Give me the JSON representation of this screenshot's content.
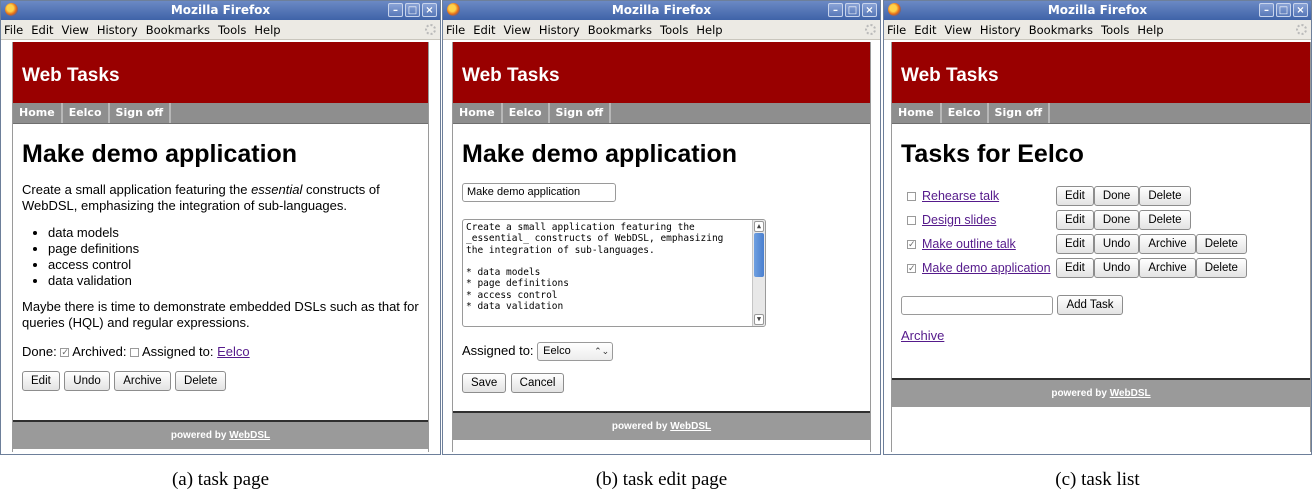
{
  "browser": {
    "title": "Mozilla Firefox",
    "menu": [
      "File",
      "Edit",
      "View",
      "History",
      "Bookmarks",
      "Tools",
      "Help"
    ],
    "window_buttons": [
      "–",
      "□",
      "×"
    ]
  },
  "site": {
    "brand": "Web Tasks",
    "nav": [
      "Home",
      "Eelco",
      "Sign off"
    ],
    "footer_prefix": "powered by ",
    "footer_link": "WebDSL"
  },
  "task_page": {
    "title": "Make demo application",
    "intro_before": "Create a small application featuring the ",
    "intro_em": "essential",
    "intro_after": " constructs of WebDSL, emphasizing the integration of sub-languages.",
    "bullets": [
      "data models",
      "page definitions",
      "access control",
      "data validation"
    ],
    "note": "Maybe there is time to demonstrate embedded DSLs such as that for queries (HQL) and regular expressions.",
    "done_label": "Done:",
    "archived_label": "Archived:",
    "assigned_label": "Assigned to:",
    "assigned_user": "Eelco",
    "done_checked": true,
    "archived_checked": false,
    "buttons": [
      "Edit",
      "Undo",
      "Archive",
      "Delete"
    ]
  },
  "task_edit_page": {
    "title": "Make demo application",
    "name_value": "Make demo application",
    "description_lines": [
      "Create a small application featuring the",
      "_essential_ constructs of WebDSL, emphasizing",
      "the integration of sub-languages.",
      "",
      "* data models",
      "* page definitions",
      "* access control",
      "* data validation"
    ],
    "assigned_label": "Assigned to:",
    "assigned_value": "Eelco",
    "save_label": "Save",
    "cancel_label": "Cancel"
  },
  "task_list": {
    "title": "Tasks for Eelco",
    "tasks": [
      {
        "name": "Rehearse talk",
        "checked": false,
        "buttons": [
          "Edit",
          "Done",
          "Delete"
        ]
      },
      {
        "name": "Design slides",
        "checked": false,
        "buttons": [
          "Edit",
          "Done",
          "Delete"
        ]
      },
      {
        "name": "Make outline talk",
        "checked": true,
        "buttons": [
          "Edit",
          "Undo",
          "Archive",
          "Delete"
        ]
      },
      {
        "name": "Make demo application",
        "checked": true,
        "buttons": [
          "Edit",
          "Undo",
          "Archive",
          "Delete"
        ]
      }
    ],
    "add_task_label": "Add Task",
    "new_task_value": "",
    "archive_link": "Archive"
  },
  "captions": [
    "(a) task page",
    "(b) task edit page",
    "(c) task list"
  ],
  "colors": {
    "header_bg": "#990000",
    "nav_bg": "#8e8e8e",
    "footer_bg": "#9a9a9a",
    "titlebar": "#4a6db4",
    "link": "#551a8b"
  },
  "icons": [
    "firefox-icon",
    "minimize-icon",
    "maximize-icon",
    "close-icon",
    "throbber-icon",
    "checkbox-icon",
    "select-arrow-icon",
    "scrollbar-arrow-icon"
  ]
}
